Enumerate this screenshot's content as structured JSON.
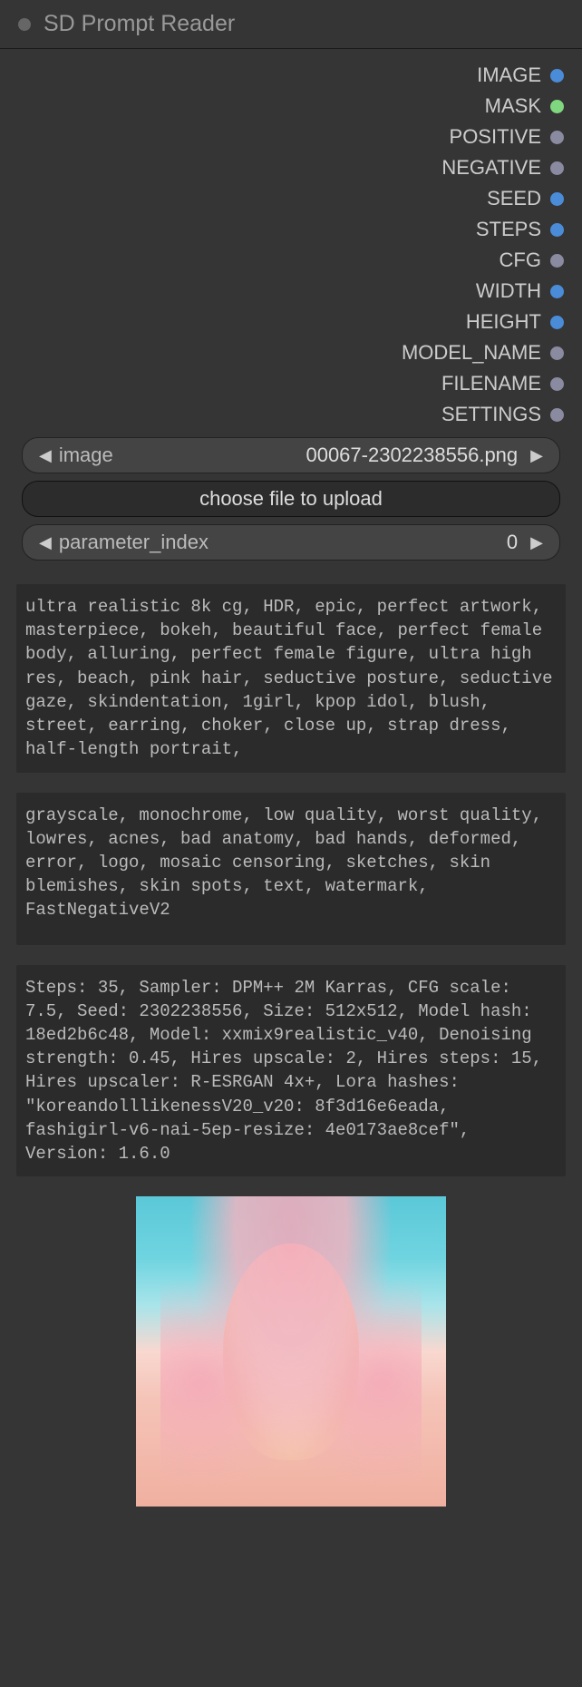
{
  "header": {
    "title": "SD Prompt Reader"
  },
  "outputs": [
    {
      "label": "IMAGE",
      "color": "blue"
    },
    {
      "label": "MASK",
      "color": "green"
    },
    {
      "label": "POSITIVE",
      "color": "gray"
    },
    {
      "label": "NEGATIVE",
      "color": "gray"
    },
    {
      "label": "SEED",
      "color": "blue"
    },
    {
      "label": "STEPS",
      "color": "blue"
    },
    {
      "label": "CFG",
      "color": "gray"
    },
    {
      "label": "WIDTH",
      "color": "blue"
    },
    {
      "label": "HEIGHT",
      "color": "blue"
    },
    {
      "label": "MODEL_NAME",
      "color": "gray"
    },
    {
      "label": "FILENAME",
      "color": "gray"
    },
    {
      "label": "SETTINGS",
      "color": "gray"
    }
  ],
  "controls": {
    "image_label": "image",
    "image_value": "00067-2302238556.png",
    "upload_label": "choose file to upload",
    "param_label": "parameter_index",
    "param_value": "0"
  },
  "positive_prompt": "ultra realistic 8k cg, HDR, epic, perfect artwork, masterpiece, bokeh, beautiful face, perfect female body, alluring, perfect female figure, ultra high res, beach, pink hair, seductive posture, seductive gaze, skindentation, 1girl, kpop idol, blush, street, earring, choker, close up, strap dress, half-length portrait,",
  "negative_prompt": "grayscale, monochrome, low quality, worst quality, lowres, acnes, bad anatomy, bad hands, deformed, error, logo, mosaic censoring, sketches, skin blemishes, skin spots, text, watermark, FastNegativeV2",
  "settings_text": "Steps: 35, Sampler: DPM++ 2M Karras, CFG scale: 7.5, Seed: 2302238556, Size: 512x512, Model hash: 18ed2b6c48, Model: xxmix9realistic_v40, Denoising strength: 0.45, Hires upscale: 2, Hires steps: 15, Hires upscaler: R-ESRGAN 4x+, Lora hashes: \"koreandolllikenessV20_v20: 8f3d16e6eada, fashigirl-v6-nai-5ep-resize: 4e0173ae8cef\", Version: 1.6.0"
}
